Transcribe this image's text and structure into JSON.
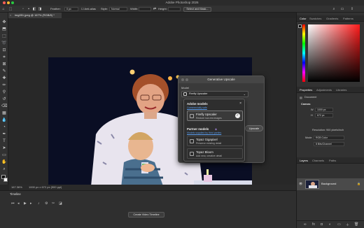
{
  "app": {
    "title": "Adobe Photoshop 2026",
    "traffic_light_colors": [
      "#ff5f57",
      "#febc2e",
      "#28c840"
    ]
  },
  "options_bar": {
    "feather_label": "Feather:",
    "feather_value": "0 px",
    "antialias_label": "Anti-alias",
    "style_label": "Style:",
    "style_value": "Normal",
    "width_label": "Width:",
    "height_label": "Height:",
    "select_mask_label": "Select and Mask..."
  },
  "document_tab": {
    "title": "img051.jpeg @ 167% (RGB/8) *",
    "close_glyph": "×"
  },
  "status_bar": {
    "zoom": "167.36%",
    "dimensions": "1000 px x 672 px (900 ppi)"
  },
  "timeline": {
    "tab_label": "Timeline",
    "create_button": "Create Video Timeline"
  },
  "dialog": {
    "title": "Generative Upscale",
    "model_label": "Model",
    "selected_model": "Firefly Upscaler",
    "upscale_button": "Upscale"
  },
  "model_popup": {
    "adobe_section": "Adobe models",
    "adobe_link": "Commercially safe",
    "partner_section": "Partner models",
    "partner_link": "Models supplied by third parties",
    "items": [
      {
        "name": "Firefly Upscaler",
        "desc": "Restore low-res images",
        "selected": true
      },
      {
        "name": "Topaz Gigapixel",
        "desc": "Preserve existing detail",
        "selected": false
      },
      {
        "name": "Topaz Bloom",
        "desc": "Add new, creative detail",
        "selected": false
      }
    ]
  },
  "right_panel": {
    "color_tabs": [
      "Color",
      "Swatches",
      "Gradients",
      "Patterns"
    ],
    "props_tabs": [
      "Properties",
      "Adjustments",
      "Libraries"
    ],
    "props_type": "Document",
    "canvas_section": "Canvas",
    "width_label": "W",
    "width_value": "1000 px",
    "height_label": "H",
    "height_value": "672 px",
    "resolution": "Resolution: 900 pixels/inch",
    "mode_label": "Mode",
    "mode_value": "RGB Color",
    "bit_value": "8 Bits/Channel",
    "layers_tabs": [
      "Layers",
      "Channels",
      "Paths"
    ],
    "layer_name": "Background",
    "accent_color": "#1473e6"
  }
}
